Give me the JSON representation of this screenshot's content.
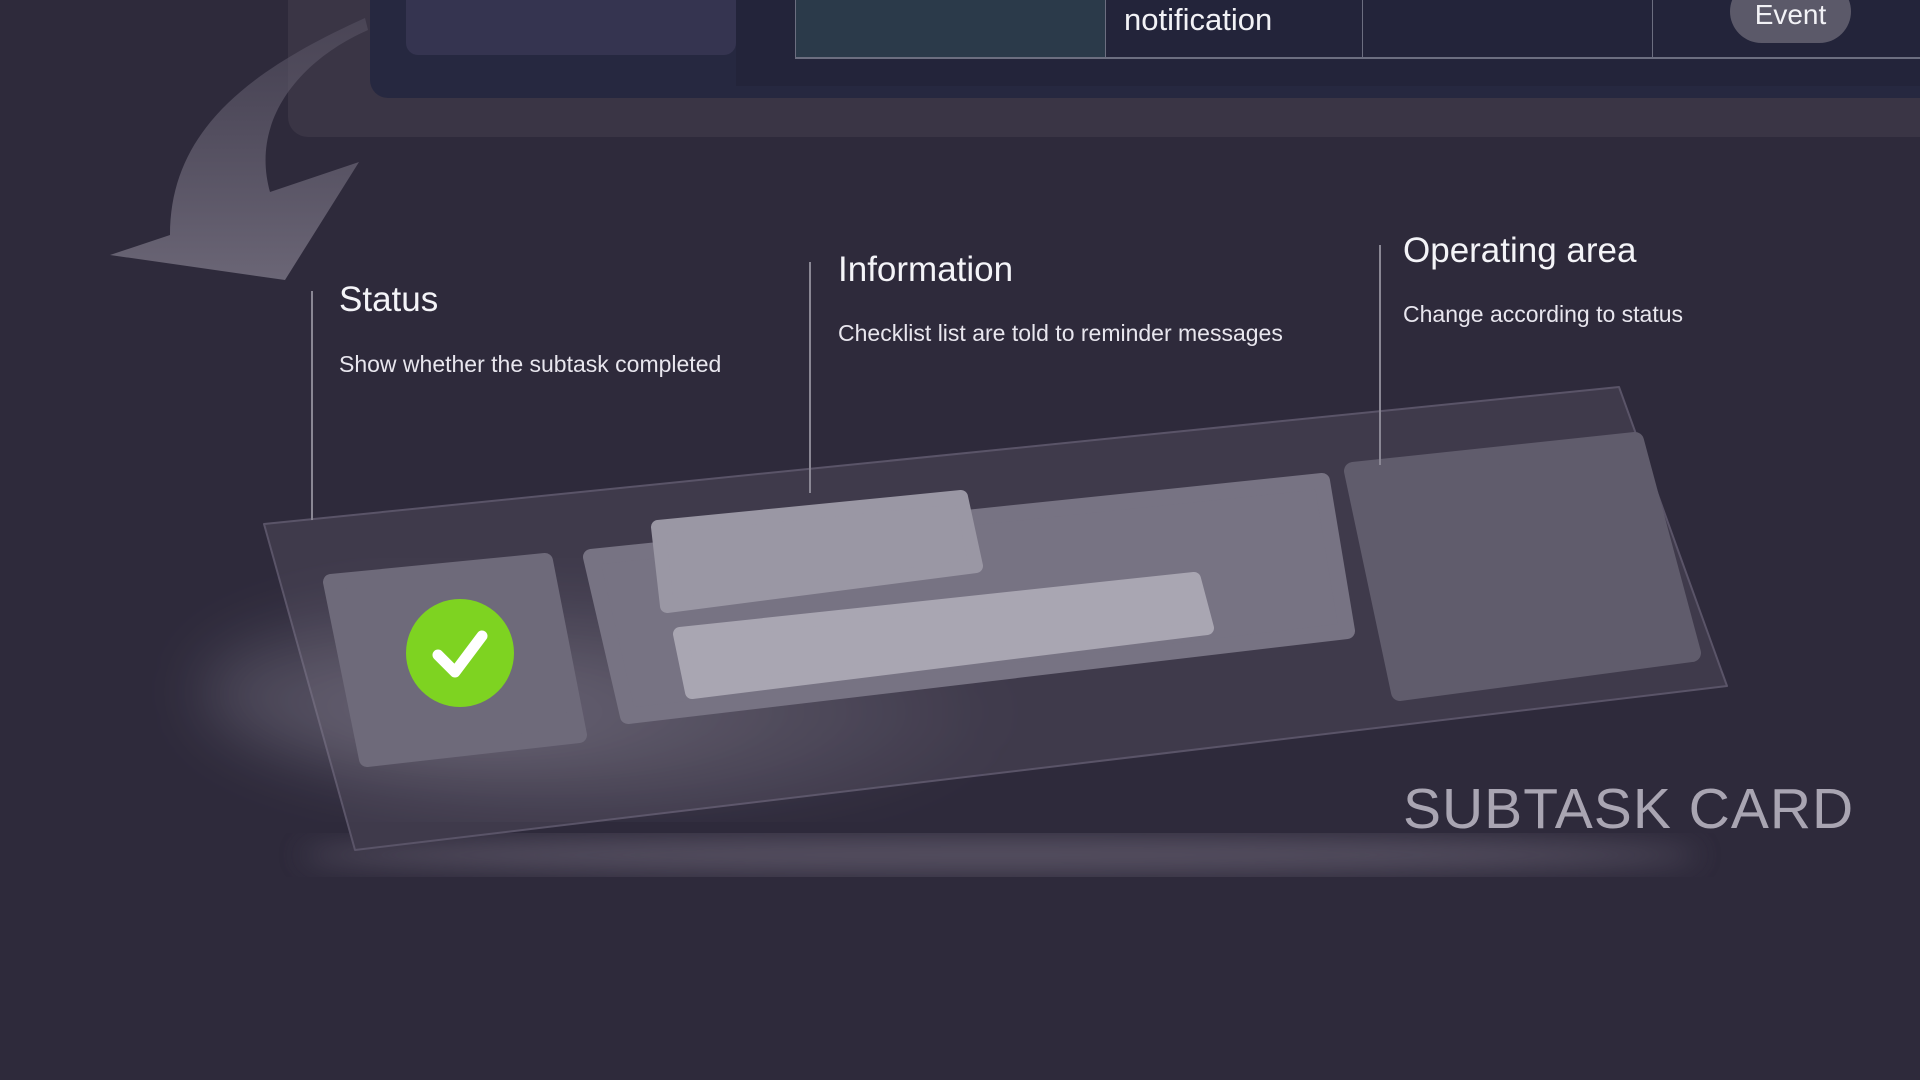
{
  "background_table": {
    "cell_text": "notification",
    "event_badge": "Event"
  },
  "annotations": [
    {
      "title": "Status",
      "description": "Show whether the subtask completed"
    },
    {
      "title": "Information",
      "description": "Checklist list are told to reminder messages"
    },
    {
      "title": "Operating area",
      "description": "Change according to status"
    }
  ],
  "card": {
    "label": "SUBTASK CARD",
    "status": "completed",
    "status_icon": "check-icon",
    "status_color": "#7ed321"
  }
}
